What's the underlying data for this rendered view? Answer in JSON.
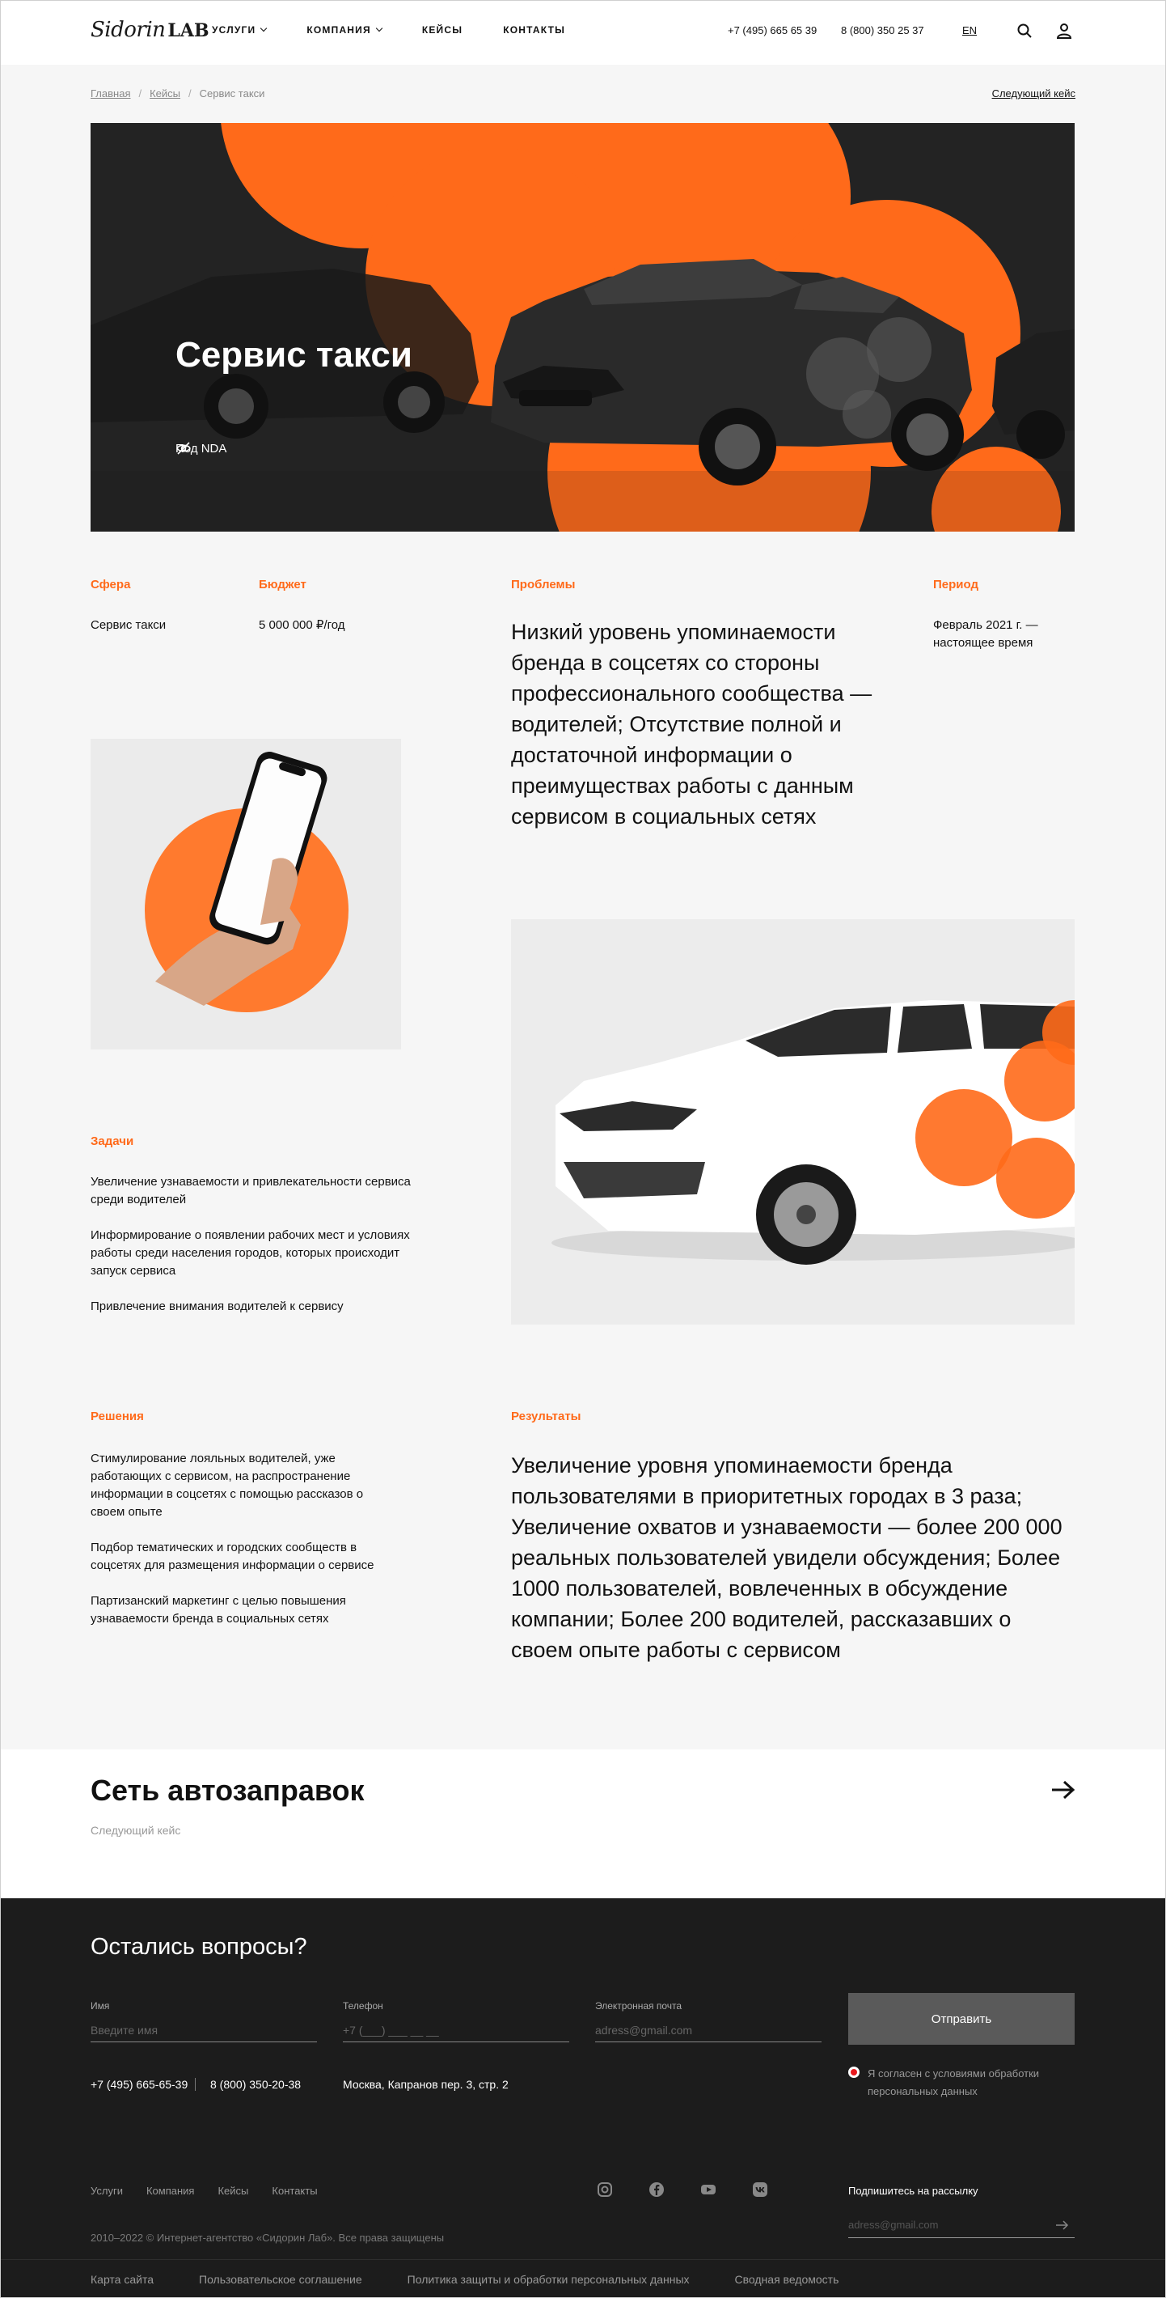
{
  "header": {
    "logo_script": "Sidorin",
    "logo_lab": "LAB",
    "nav": [
      {
        "label": "УСЛУГИ",
        "dropdown": true
      },
      {
        "label": "КОМПАНИЯ",
        "dropdown": true
      },
      {
        "label": "КЕЙСЫ",
        "dropdown": false
      },
      {
        "label": "КОНТАКТЫ",
        "dropdown": false
      }
    ],
    "phone_1": "+7 (495) 665 65 39",
    "phone_2": "8 (800) 350 25 37",
    "lang": "EN"
  },
  "breadcrumbs": {
    "home": "Главная",
    "cases": "Кейсы",
    "current": "Сервис такси",
    "next_link": "Следующий кейс"
  },
  "hero": {
    "title": "Сервис такси",
    "nda_label": "Под NDA"
  },
  "info": {
    "sphere_label": "Сфера",
    "sphere_value": "Сервис такси",
    "budget_label": "Бюджет",
    "budget_value": "5 000 000 ₽/год",
    "problems_label": "Проблемы",
    "problems_text": "Низкий уровень упоминаемости бренда в соцсетях со стороны профессионального сообщества — водителей; Отсутствие полной и достаточной информации о преимуществах работы с данным сервисом в социальных сетях",
    "period_label": "Период",
    "period_value": "Февраль 2021 г. — настоящее время"
  },
  "tasks": {
    "label": "Задачи",
    "items": [
      "Увеличение узнаваемости и привлекательности сервиса среди водителей",
      "Информирование о появлении рабочих мест и условиях работы среди населения городов, которых происходит запуск сервиса",
      "Привлечение внимания водителей к сервису"
    ]
  },
  "solutions": {
    "label": "Решения",
    "items": [
      "Стимулирование лояльных водителей, уже работающих с сервисом, на распространение информации в соцсетях с помощью рассказов о своем опыте",
      "Подбор тематических и городских сообществ в соцсетях для размещения информации о сервисе",
      "Партизанский маркетинг с целью повышения узнаваемости бренда в социальных сетях"
    ]
  },
  "results": {
    "label": "Результаты",
    "text": "Увеличение уровня упоминаемости бренда пользователями в приоритетных городах в 3 раза; Увеличение охватов и узнаваемости — более 200 000 реальных пользователей увидели обсуждения; Более 1000 пользователей, вовлеченных в обсуждение компании; Более 200 водителей, рассказавших о своем опыте работы с сервисом"
  },
  "next_case": {
    "title": "Сеть автозаправок",
    "subtitle": "Следующий кейс"
  },
  "footer": {
    "title": "Остались вопросы?",
    "name_label": "Имя",
    "name_placeholder": "Введите имя",
    "phone_label": "Телефон",
    "phone_placeholder": "+7 (___) ___ __ __",
    "email_label": "Электронная почта",
    "email_placeholder": "adress@gmail.com",
    "submit": "Отправить",
    "contact_phone_1": "+7 (495) 665-65-39",
    "contact_phone_2": "8 (800) 350-20-38",
    "address": "Москва, Капранов пер. 3, стр. 2",
    "consent": "Я согласен с условиями обработки персональных данных",
    "menu": [
      "Услуги",
      "Компания",
      "Кейсы",
      "Контакты"
    ],
    "social_icons": [
      "instagram-icon",
      "facebook-icon",
      "youtube-icon",
      "vk-icon"
    ],
    "subscribe_label": "Подпишитесь на рассылку",
    "subscribe_placeholder": "adress@gmail.com",
    "copyright": "2010–2022 © Интернет-агентство «Сидорин Лаб». Все права защищены",
    "bottom_links": [
      "Карта сайта",
      "Пользовательское соглашение",
      "Политика защиты и обработки персональных данных",
      "Сводная ведомость"
    ]
  },
  "colors": {
    "accent": "#ff6a1a",
    "footer_bg": "#1c1c1c",
    "page_bg": "#f6f6f6",
    "consent_dot": "#e8191e"
  }
}
